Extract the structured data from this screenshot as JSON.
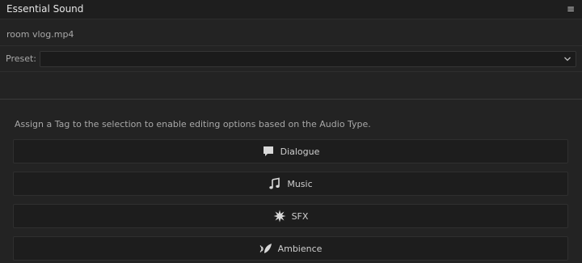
{
  "header": {
    "title": "Essential Sound",
    "menu_icon": "hamburger-menu-icon"
  },
  "clip": {
    "name": "room vlog.mp4"
  },
  "preset": {
    "label": "Preset:",
    "value": "",
    "chevron_icon": "chevron-down-icon"
  },
  "hint": "Assign a Tag to the selection to enable editing options based on the Audio Type.",
  "tags": [
    {
      "label": "Dialogue",
      "icon": "speech-bubble-icon"
    },
    {
      "label": "Music",
      "icon": "music-note-icon"
    },
    {
      "label": "SFX",
      "icon": "starburst-icon"
    },
    {
      "label": "Ambience",
      "icon": "leaf-sound-icon"
    }
  ],
  "colors": {
    "background": "#232323",
    "header": "#1e1e1e",
    "button": "#1d1d1d",
    "text": "#cfcfcf"
  }
}
